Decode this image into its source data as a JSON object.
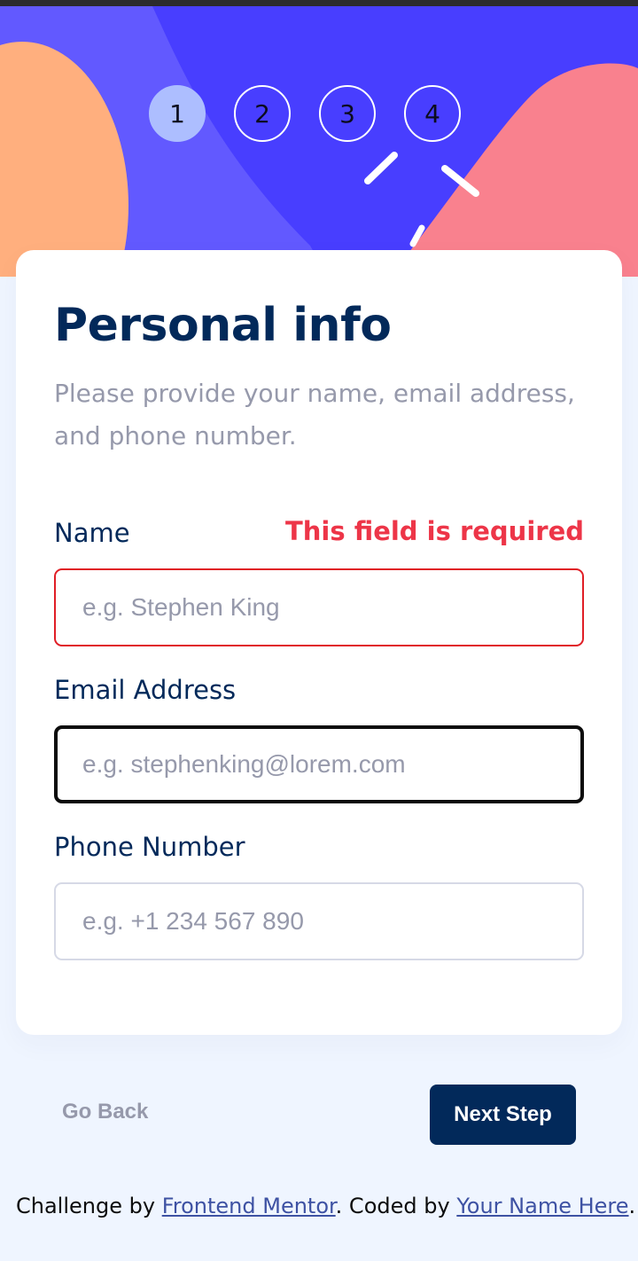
{
  "colors": {
    "hero_blue": "#483eff",
    "hero_violet": "#6259ff",
    "hero_orange": "#ffaf7e",
    "hero_pink": "#f9818e",
    "marine_blue": "#02295a",
    "error_red": "#e01e26",
    "step_active": "#adbeff",
    "page_bg": "#eff5ff"
  },
  "steps": [
    {
      "number": "1",
      "active": true
    },
    {
      "number": "2",
      "active": false
    },
    {
      "number": "3",
      "active": false
    },
    {
      "number": "4",
      "active": false
    }
  ],
  "form": {
    "title": "Personal info",
    "subtitle": "Please provide your name, email address, and phone number.",
    "fields": {
      "name": {
        "label": "Name",
        "placeholder": "e.g. Stephen King",
        "value": "",
        "error": "This field is required"
      },
      "email": {
        "label": "Email Address",
        "placeholder": "e.g. stephenking@lorem.com",
        "value": ""
      },
      "phone": {
        "label": "Phone Number",
        "placeholder": "e.g. +1 234 567 890",
        "value": ""
      }
    }
  },
  "nav": {
    "back_label": "Go Back",
    "next_label": "Next Step"
  },
  "attribution": {
    "prefix": "Challenge by ",
    "link1": "Frontend Mentor",
    "middle": ". Coded by ",
    "link2": "Your Name Here",
    "suffix": "."
  }
}
